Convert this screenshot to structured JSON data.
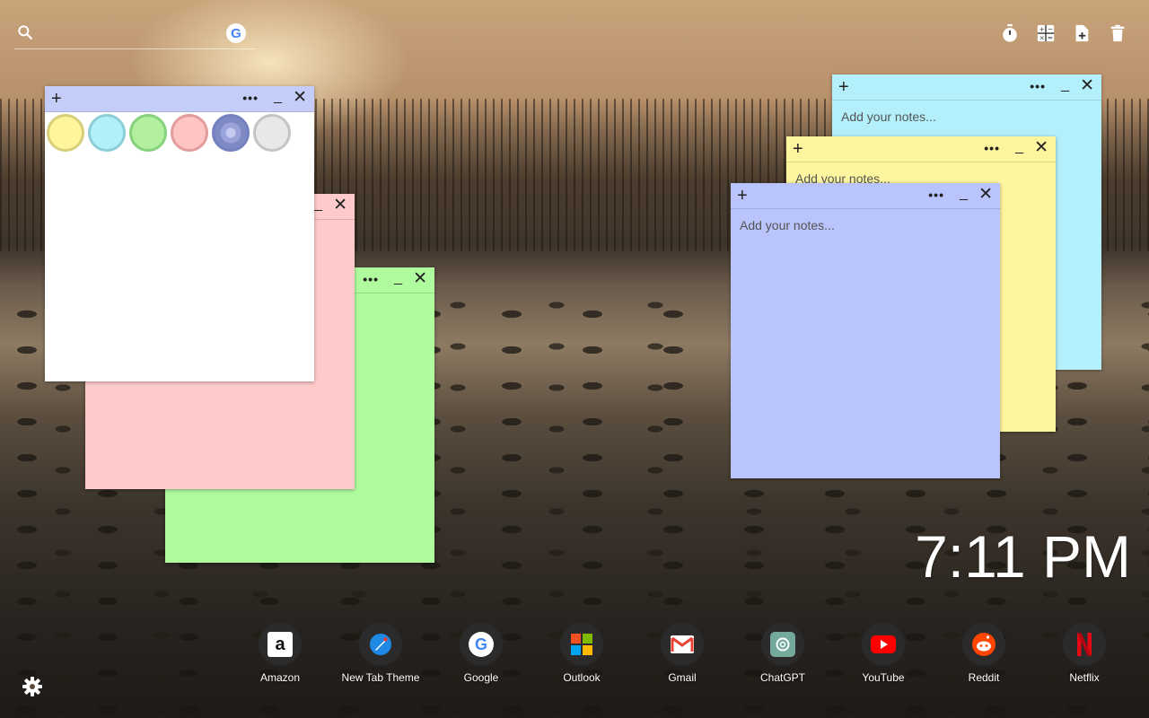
{
  "search": {
    "placeholder": "",
    "google_letter": "G"
  },
  "tools": [
    "timer-icon",
    "calculator-icon",
    "new-note-icon",
    "trash-icon"
  ],
  "notes": {
    "plus": "+",
    "more": "•••",
    "minimize": "_",
    "close": "✕",
    "placeholder": "Add your notes...",
    "palette_colors": [
      "#fff59d",
      "#b2f0f7",
      "#b2f0a0",
      "#ffc4c4",
      "#aab4e8",
      "#e8e8e8"
    ],
    "palette_borders": [
      "#d6cf78",
      "#8ccfd8",
      "#86d17c",
      "#e39c9c",
      "#7580c0",
      "#c4c4c4"
    ],
    "colors": {
      "white": "#ffffff",
      "pink": "#ffcaca",
      "green": "#b0fb9e",
      "cyan": "#b3f0fb",
      "yellow": "#fef59f",
      "blue": "#b9c4fc"
    }
  },
  "clock": {
    "time": "7:11 PM"
  },
  "dock": [
    {
      "label": "Amazon",
      "icon": "amazon-icon"
    },
    {
      "label": "New Tab Theme",
      "icon": "new-tab-theme-icon"
    },
    {
      "label": "Google",
      "icon": "google-icon"
    },
    {
      "label": "Outlook",
      "icon": "outlook-icon"
    },
    {
      "label": "Gmail",
      "icon": "gmail-icon"
    },
    {
      "label": "ChatGPT",
      "icon": "chatgpt-icon"
    },
    {
      "label": "YouTube",
      "icon": "youtube-icon"
    },
    {
      "label": "Reddit",
      "icon": "reddit-icon"
    },
    {
      "label": "Netflix",
      "icon": "netflix-icon"
    }
  ]
}
